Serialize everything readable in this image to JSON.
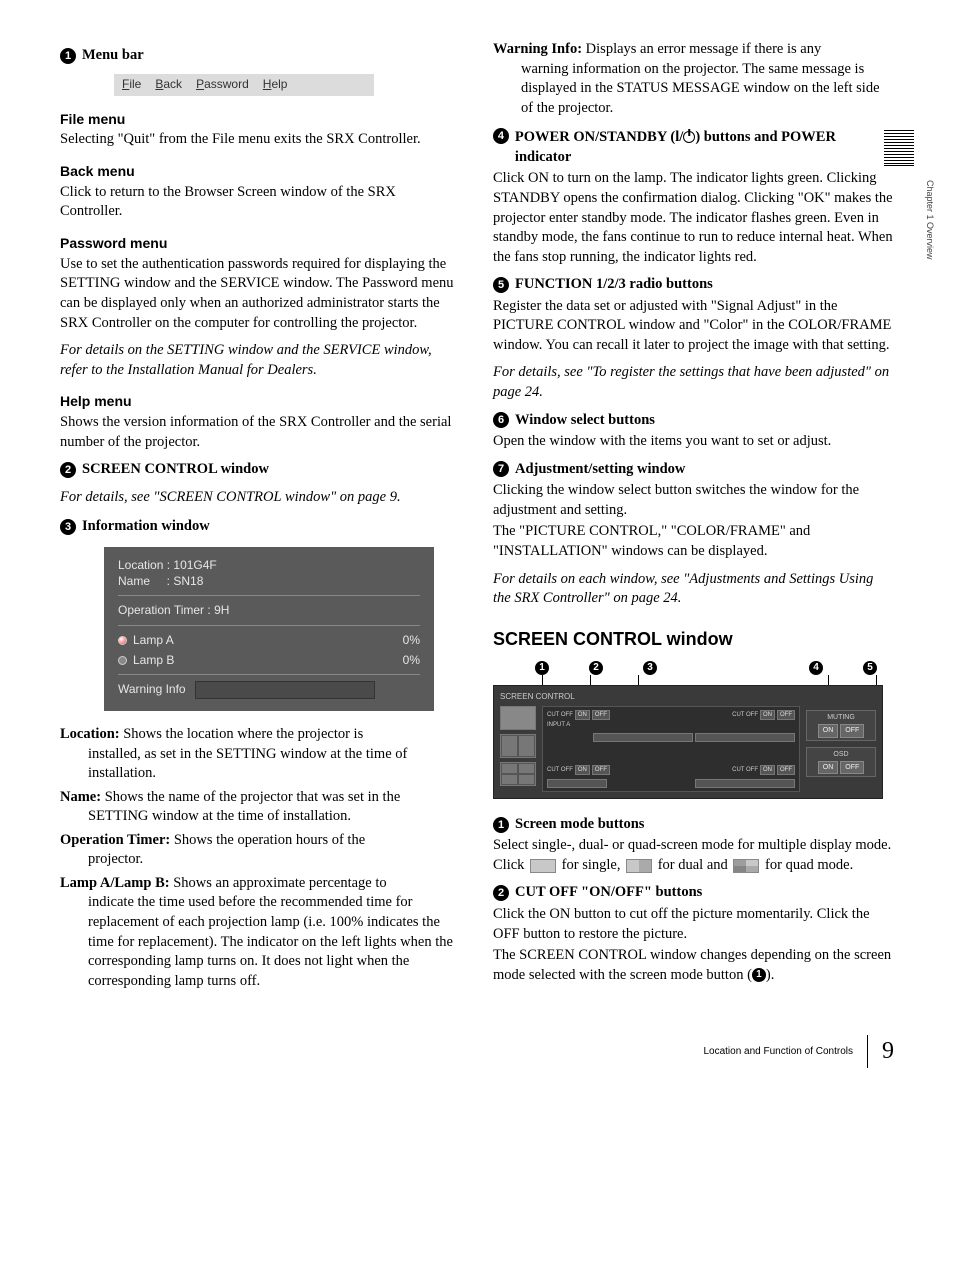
{
  "side_tab": "Chapter 1  Overview",
  "left": {
    "item1": {
      "title": "Menu bar"
    },
    "menubar": {
      "file": "File",
      "back": "Back",
      "password": "Password",
      "help": "Help"
    },
    "file_menu": {
      "h": "File menu",
      "p": "Selecting \"Quit\" from the File menu exits the SRX Controller."
    },
    "back_menu": {
      "h": "Back menu",
      "p": "Click to return to the Browser Screen window of the SRX Controller."
    },
    "password_menu": {
      "h": "Password menu",
      "p": "Use to set the authentication passwords required for displaying the SETTING window and the SERVICE window. The Password menu can be displayed only when an authorized administrator starts the SRX Controller on the computer for controlling the projector."
    },
    "password_note": "For details on the SETTING window and the SERVICE window, refer to the Installation Manual for Dealers.",
    "help_menu": {
      "h": "Help menu",
      "p": "Shows the version information of the SRX Controller and the serial number of the projector."
    },
    "item2": {
      "title": "SCREEN CONTROL window",
      "note": "For details, see \"SCREEN CONTROL window\" on page 9."
    },
    "item3": {
      "title": "Information window"
    },
    "info_window": {
      "location_lbl": "Location",
      "location_val": "101G4F",
      "name_lbl": "Name",
      "name_val": "SN18",
      "optimer_lbl": "Operation Timer",
      "optimer_val": "9H",
      "lampA": "Lamp A",
      "lampA_pct": "0%",
      "lampB": "Lamp B",
      "lampB_pct": "0%",
      "warn": "Warning Info"
    },
    "defs": {
      "location": {
        "t": "Location:",
        "b": "Shows the location where the projector is installed, as set in the SETTING window at the time of installation."
      },
      "name": {
        "t": "Name:",
        "b": "Shows the name of the projector that was set in the SETTING window at the time of installation."
      },
      "optimer": {
        "t": "Operation Timer:",
        "b": "Shows the operation hours of the projector."
      },
      "lamp": {
        "t": "Lamp A/Lamp B:",
        "b": "Shows an approximate percentage to indicate the time used before the recommended time for replacement of each projection lamp (i.e. 100% indicates the time for replacement). The indicator on the left lights when the corresponding lamp turns on. It does not light when the corresponding lamp turns off."
      }
    }
  },
  "right": {
    "warning_info": {
      "t": "Warning Info:",
      "b": "Displays an error message if there is any warning information on the projector. The same message is displayed in the STATUS MESSAGE window on the left side of the projector."
    },
    "item4": {
      "title_a": "POWER ON/STANDBY (",
      "title_b": ") buttons and POWER indicator",
      "sym_prefix": "l/",
      "p": "Click ON to turn on the lamp. The indicator lights green. Clicking STANDBY opens the confirmation dialog. Clicking \"OK\" makes the projector enter standby mode. The indicator flashes green. Even in standby mode, the fans continue to run to reduce internal heat. When the fans stop running, the indicator lights red."
    },
    "item5": {
      "title": "FUNCTION 1/2/3 radio buttons",
      "p": "Register the data set or adjusted with \"Signal Adjust\" in the PICTURE CONTROL window and \"Color\" in the COLOR/FRAME window. You can recall it later to project the image with that setting.",
      "note": "For details, see \"To register the settings that have been adjusted\" on page 24."
    },
    "item6": {
      "title": "Window select buttons",
      "p": "Open the window with the items you want to set or adjust."
    },
    "item7": {
      "title": "Adjustment/setting window",
      "p1": "Clicking the window select button switches the window for the adjustment and setting.",
      "p2": "The \"PICTURE CONTROL,\" \"COLOR/FRAME\" and \"INSTALLATION\" windows can be displayed.",
      "note": "For details on each window, see \"Adjustments and Settings Using the SRX Controller\" on page 24."
    },
    "section_title": "SCREEN CONTROL window",
    "sc_fig": {
      "title": "SCREEN CONTROL",
      "cutoff": "CUT OFF",
      "on": "ON",
      "off": "OFF",
      "inputA": "INPUT A",
      "muting": "MUTING",
      "osd": "OSD"
    },
    "sc_item1": {
      "title": "Screen mode buttons",
      "p_a": "Select single-, dual- or quad-screen mode for multiple display mode. Click ",
      "p_b": " for single, ",
      "p_c": " for dual and ",
      "p_d": " for quad mode."
    },
    "sc_item2": {
      "title": "CUT OFF \"ON/OFF\" buttons",
      "p1": "Click the ON button to cut off the picture momentarily. Click the OFF button to restore the picture.",
      "p2a": "The SCREEN CONTROL window changes depending on the screen mode selected with the screen mode button (",
      "p2b": ")."
    }
  },
  "footer": {
    "label": "Location and Function of Controls",
    "page": "9"
  }
}
